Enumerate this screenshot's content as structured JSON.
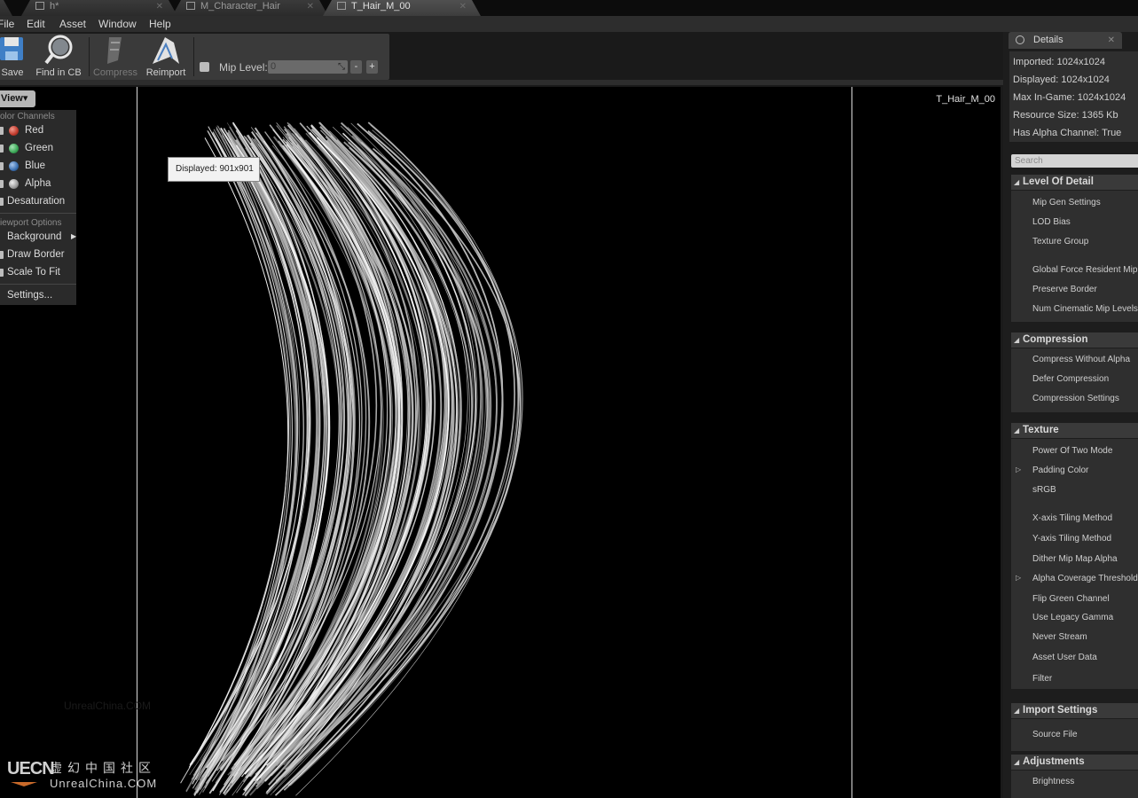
{
  "tabs": [
    {
      "label": "h*",
      "active": false
    },
    {
      "label": "M_Character_Hair",
      "active": false
    },
    {
      "label": "T_Hair_M_00",
      "active": true
    }
  ],
  "menu": [
    "File",
    "Edit",
    "Asset",
    "Window",
    "Help"
  ],
  "toolbar": {
    "save": "Save",
    "find": "Find in CB",
    "compress": "Compress",
    "reimport": "Reimport",
    "mip_label": "Mip Level:",
    "mip_value": "0",
    "minus": "-",
    "plus": "+"
  },
  "viewport": {
    "asset_name": "T_Hair_M_00",
    "tooltip": "Displayed: 901x901",
    "view_button": "View▾",
    "watermark": "UnrealChina.COM",
    "logo_mark": "UECN",
    "logo_cn": "虚幻中国社区",
    "logo_en": "UnrealChina.COM"
  },
  "view_menu": {
    "color_channels": "olor Channels",
    "red": "Red",
    "green": "Green",
    "blue": "Blue",
    "alpha": "Alpha",
    "desaturation": "Desaturation",
    "viewport_options": "iewport Options",
    "background": "Background",
    "draw_border": "Draw Border",
    "scale_to_fit": "Scale To Fit",
    "settings": "Settings..."
  },
  "details": {
    "tab": "Details",
    "imported": "Imported: 1024x1024",
    "displayed": "Displayed: 1024x1024",
    "max_ingame": "Max In-Game: 1024x1024",
    "resource_size": "Resource Size: 1365 Kb",
    "has_alpha": "Has Alpha Channel: True",
    "search_placeholder": "Search",
    "lod": {
      "title": "Level Of Detail",
      "items": [
        "Mip Gen Settings",
        "LOD Bias",
        "Texture Group",
        "Global Force Resident Mip Le",
        "Preserve Border",
        "Num Cinematic Mip Levels"
      ]
    },
    "compression": {
      "title": "Compression",
      "items": [
        "Compress Without Alpha",
        "Defer Compression",
        "Compression Settings"
      ]
    },
    "texture": {
      "title": "Texture",
      "items": [
        "Power Of Two Mode",
        "Padding Color",
        "sRGB",
        "X-axis Tiling Method",
        "Y-axis Tiling Method",
        "Dither Mip Map Alpha",
        "Alpha Coverage Thresholds",
        "Flip Green Channel",
        "Use Legacy Gamma",
        "Never Stream",
        "Asset User Data",
        "Filter"
      ]
    },
    "import": {
      "title": "Import Settings",
      "items": [
        "Source File"
      ]
    },
    "adjustments": {
      "title": "Adjustments",
      "items": [
        "Brightness"
      ]
    }
  },
  "colors": {
    "red_ball": "#c0392b",
    "green_ball": "#3aa655",
    "blue_ball": "#3a6fb0",
    "alpha_ball": "#bdbdbd"
  }
}
